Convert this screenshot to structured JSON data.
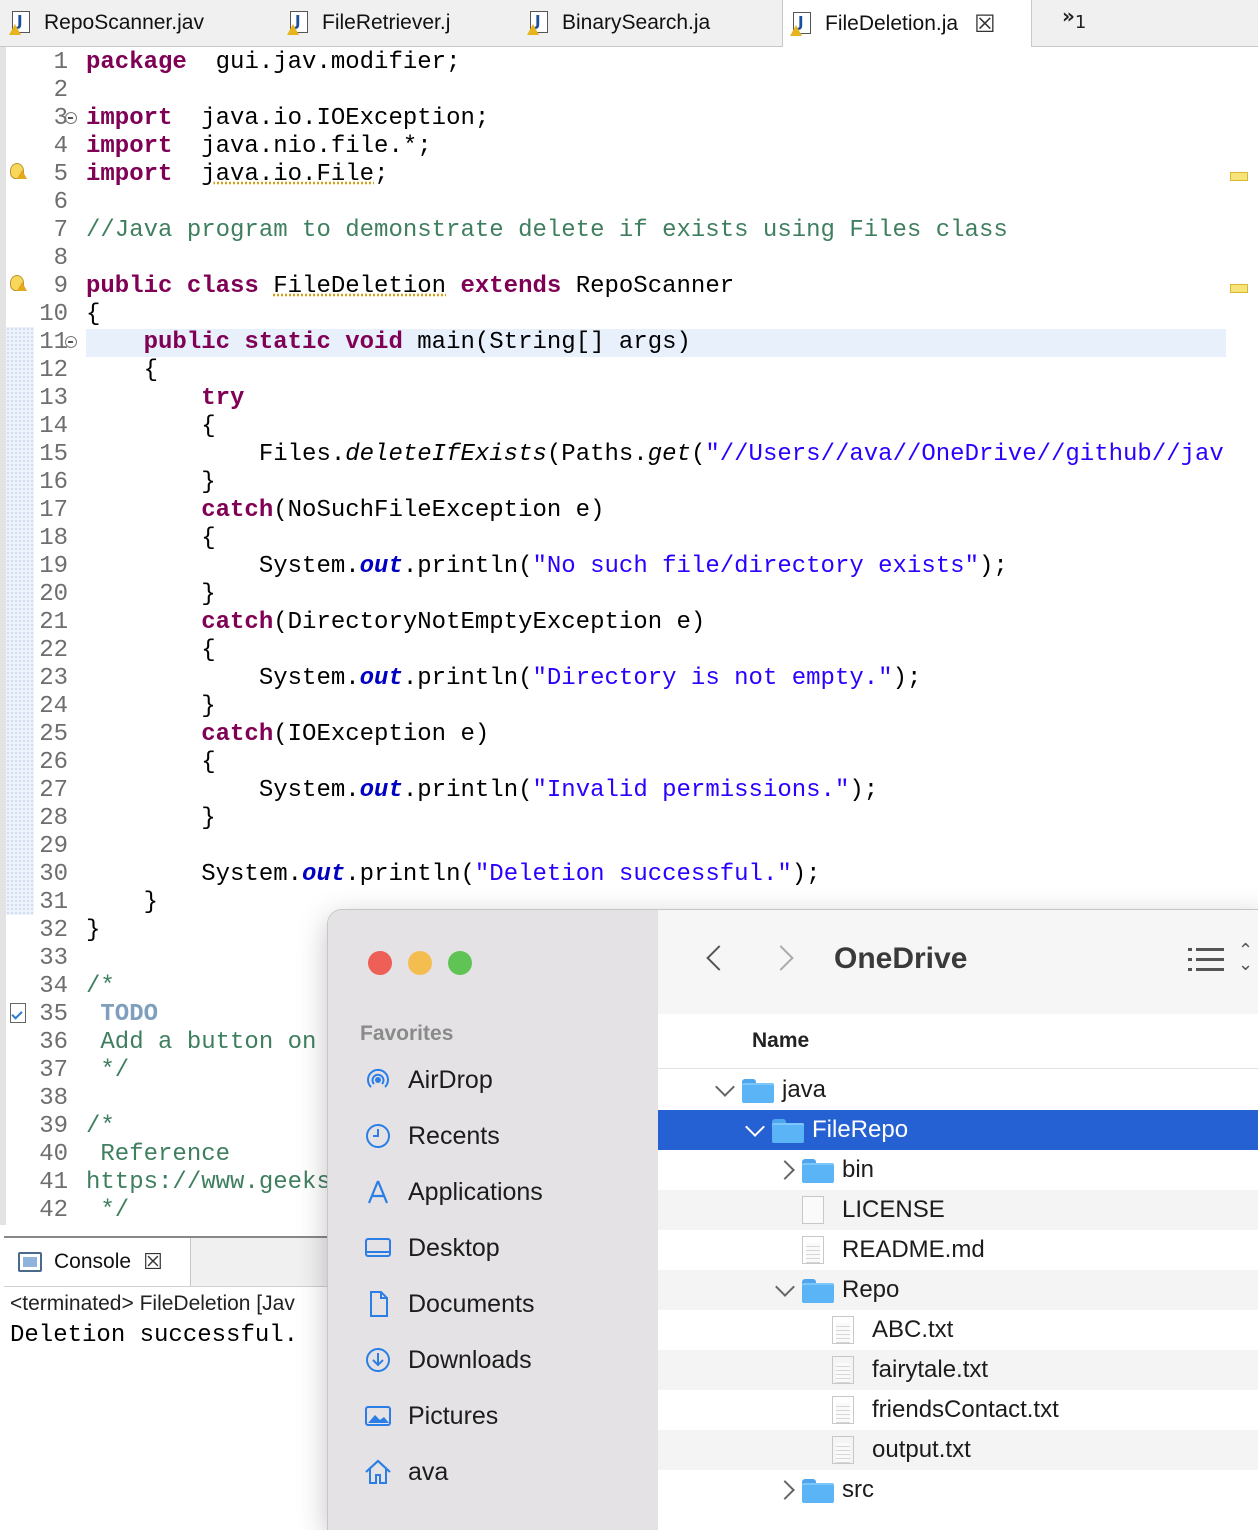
{
  "tabs": [
    {
      "label": "RepoScanner.jav",
      "active": false
    },
    {
      "label": "FileRetriever.j",
      "active": false
    },
    {
      "label": "BinarySearch.ja",
      "active": false
    },
    {
      "label": "FileDeletion.ja",
      "active": true
    }
  ],
  "tab_close": "☒",
  "tab_overflow": {
    "glyph": "»",
    "count": "1"
  },
  "editor": {
    "lines": [
      {
        "n": "1",
        "segs": [
          [
            "kw",
            "package"
          ],
          [
            "",
            "  gui.jav.modifier;"
          ]
        ]
      },
      {
        "n": "2",
        "segs": []
      },
      {
        "n": "3",
        "segs": [
          [
            "kw",
            "import"
          ],
          [
            "",
            "  java.io.IOException;"
          ]
        ],
        "fold": true
      },
      {
        "n": "4",
        "segs": [
          [
            "kw",
            "import"
          ],
          [
            "",
            "  java.nio.file.*;"
          ]
        ]
      },
      {
        "n": "5",
        "segs": [
          [
            "kw",
            "import"
          ],
          [
            "",
            "  "
          ],
          [
            "ul",
            "java.io.File"
          ],
          [
            "",
            ";"
          ]
        ],
        "marker": "warning",
        "overview": true
      },
      {
        "n": "6",
        "segs": []
      },
      {
        "n": "7",
        "segs": [
          [
            "cm",
            "//Java program to demonstrate delete if exists using Files class"
          ]
        ]
      },
      {
        "n": "8",
        "segs": []
      },
      {
        "n": "9",
        "segs": [
          [
            "kw",
            "public class"
          ],
          [
            "",
            " "
          ],
          [
            "ul",
            "FileDeletion"
          ],
          [
            "",
            " "
          ],
          [
            "kw",
            "extends"
          ],
          [
            "",
            " RepoScanner"
          ]
        ],
        "marker": "warning",
        "overview": true
      },
      {
        "n": "10",
        "segs": [
          [
            "",
            "{"
          ]
        ]
      },
      {
        "n": "11",
        "segs": [
          [
            "",
            "    "
          ],
          [
            "kw",
            "public static void"
          ],
          [
            "",
            " main(String[] args)"
          ]
        ],
        "fold": true,
        "current": true
      },
      {
        "n": "12",
        "segs": [
          [
            "",
            "    {"
          ]
        ]
      },
      {
        "n": "13",
        "segs": [
          [
            "",
            "        "
          ],
          [
            "kw",
            "try"
          ]
        ]
      },
      {
        "n": "14",
        "segs": [
          [
            "",
            "        {"
          ]
        ]
      },
      {
        "n": "15",
        "segs": [
          [
            "",
            "            Files."
          ],
          [
            "it",
            "deleteIfExists"
          ],
          [
            "",
            "(Paths."
          ],
          [
            "it",
            "get"
          ],
          [
            "",
            "("
          ],
          [
            "st",
            "\"//Users//ava//OneDrive//github//jav"
          ]
        ]
      },
      {
        "n": "16",
        "segs": [
          [
            "",
            "        }"
          ]
        ]
      },
      {
        "n": "17",
        "segs": [
          [
            "",
            "        "
          ],
          [
            "kw",
            "catch"
          ],
          [
            "",
            "(NoSuchFileException e)"
          ]
        ]
      },
      {
        "n": "18",
        "segs": [
          [
            "",
            "        {"
          ]
        ]
      },
      {
        "n": "19",
        "segs": [
          [
            "",
            "            System."
          ],
          [
            "fl",
            "out"
          ],
          [
            "",
            ".println("
          ],
          [
            "st",
            "\"No such file/directory exists\""
          ],
          [
            "",
            ");"
          ]
        ]
      },
      {
        "n": "20",
        "segs": [
          [
            "",
            "        }"
          ]
        ]
      },
      {
        "n": "21",
        "segs": [
          [
            "",
            "        "
          ],
          [
            "kw",
            "catch"
          ],
          [
            "",
            "(DirectoryNotEmptyException e)"
          ]
        ]
      },
      {
        "n": "22",
        "segs": [
          [
            "",
            "        {"
          ]
        ]
      },
      {
        "n": "23",
        "segs": [
          [
            "",
            "            System."
          ],
          [
            "fl",
            "out"
          ],
          [
            "",
            ".println("
          ],
          [
            "st",
            "\"Directory is not empty.\""
          ],
          [
            "",
            ");"
          ]
        ]
      },
      {
        "n": "24",
        "segs": [
          [
            "",
            "        }"
          ]
        ]
      },
      {
        "n": "25",
        "segs": [
          [
            "",
            "        "
          ],
          [
            "kw",
            "catch"
          ],
          [
            "",
            "(IOException e)"
          ]
        ]
      },
      {
        "n": "26",
        "segs": [
          [
            "",
            "        {"
          ]
        ]
      },
      {
        "n": "27",
        "segs": [
          [
            "",
            "            System."
          ],
          [
            "fl",
            "out"
          ],
          [
            "",
            ".println("
          ],
          [
            "st",
            "\"Invalid permissions.\""
          ],
          [
            "",
            ");"
          ]
        ]
      },
      {
        "n": "28",
        "segs": [
          [
            "",
            "        }"
          ]
        ]
      },
      {
        "n": "29",
        "segs": []
      },
      {
        "n": "30",
        "segs": [
          [
            "",
            "        System."
          ],
          [
            "fl",
            "out"
          ],
          [
            "",
            ".println("
          ],
          [
            "st",
            "\"Deletion successful.\""
          ],
          [
            "",
            ");"
          ]
        ]
      },
      {
        "n": "31",
        "segs": [
          [
            "",
            "    }"
          ]
        ]
      },
      {
        "n": "32",
        "segs": [
          [
            "",
            "}"
          ]
        ]
      },
      {
        "n": "33",
        "segs": []
      },
      {
        "n": "34",
        "segs": [
          [
            "cm",
            "/*"
          ]
        ]
      },
      {
        "n": "35",
        "segs": [
          [
            "tg",
            " TODO"
          ]
        ],
        "marker": "task"
      },
      {
        "n": "36",
        "segs": [
          [
            "cm",
            " Add a button on"
          ]
        ]
      },
      {
        "n": "37",
        "segs": [
          [
            "cm",
            " */"
          ]
        ]
      },
      {
        "n": "38",
        "segs": []
      },
      {
        "n": "39",
        "segs": [
          [
            "cm",
            "/*"
          ]
        ]
      },
      {
        "n": "40",
        "segs": [
          [
            "cm",
            " Reference"
          ]
        ]
      },
      {
        "n": "41",
        "segs": [
          [
            "cm",
            "https://www.geeks"
          ]
        ]
      },
      {
        "n": "42",
        "segs": [
          [
            "cm",
            " */"
          ]
        ]
      }
    ]
  },
  "console": {
    "tab_label": "Console",
    "close": "☒",
    "status": "<terminated> FileDeletion [Jav",
    "output": "Deletion successful."
  },
  "finder": {
    "title": "OneDrive",
    "favorites_heading": "Favorites",
    "sidebar": [
      {
        "label": "AirDrop",
        "icon": "airdrop-icon"
      },
      {
        "label": "Recents",
        "icon": "clock-icon"
      },
      {
        "label": "Applications",
        "icon": "applications-icon"
      },
      {
        "label": "Desktop",
        "icon": "desktop-icon"
      },
      {
        "label": "Documents",
        "icon": "document-icon"
      },
      {
        "label": "Downloads",
        "icon": "download-icon"
      },
      {
        "label": "Pictures",
        "icon": "pictures-icon"
      },
      {
        "label": "ava",
        "icon": "home-icon"
      }
    ],
    "column_header": "Name",
    "rows": [
      {
        "name": "java",
        "kind": "folder",
        "depth": 0,
        "chevron": "open"
      },
      {
        "name": "FileRepo",
        "kind": "folder",
        "depth": 1,
        "chevron": "open",
        "selected": true
      },
      {
        "name": "bin",
        "kind": "folder",
        "depth": 2,
        "chevron": "closed"
      },
      {
        "name": "LICENSE",
        "kind": "file",
        "depth": 2
      },
      {
        "name": "README.md",
        "kind": "txt",
        "depth": 2
      },
      {
        "name": "Repo",
        "kind": "folder",
        "depth": 2,
        "chevron": "open"
      },
      {
        "name": "ABC.txt",
        "kind": "txt",
        "depth": 3
      },
      {
        "name": "fairytale.txt",
        "kind": "txt",
        "depth": 3
      },
      {
        "name": "friendsContact.txt",
        "kind": "txt",
        "depth": 3
      },
      {
        "name": "output.txt",
        "kind": "txt",
        "depth": 3
      },
      {
        "name": "src",
        "kind": "folder",
        "depth": 2,
        "chevron": "closed"
      }
    ],
    "colors": {
      "selection": "#2661d4",
      "close": "#ed5f57",
      "minimize": "#f4bd4f",
      "zoom": "#5fc454"
    }
  }
}
